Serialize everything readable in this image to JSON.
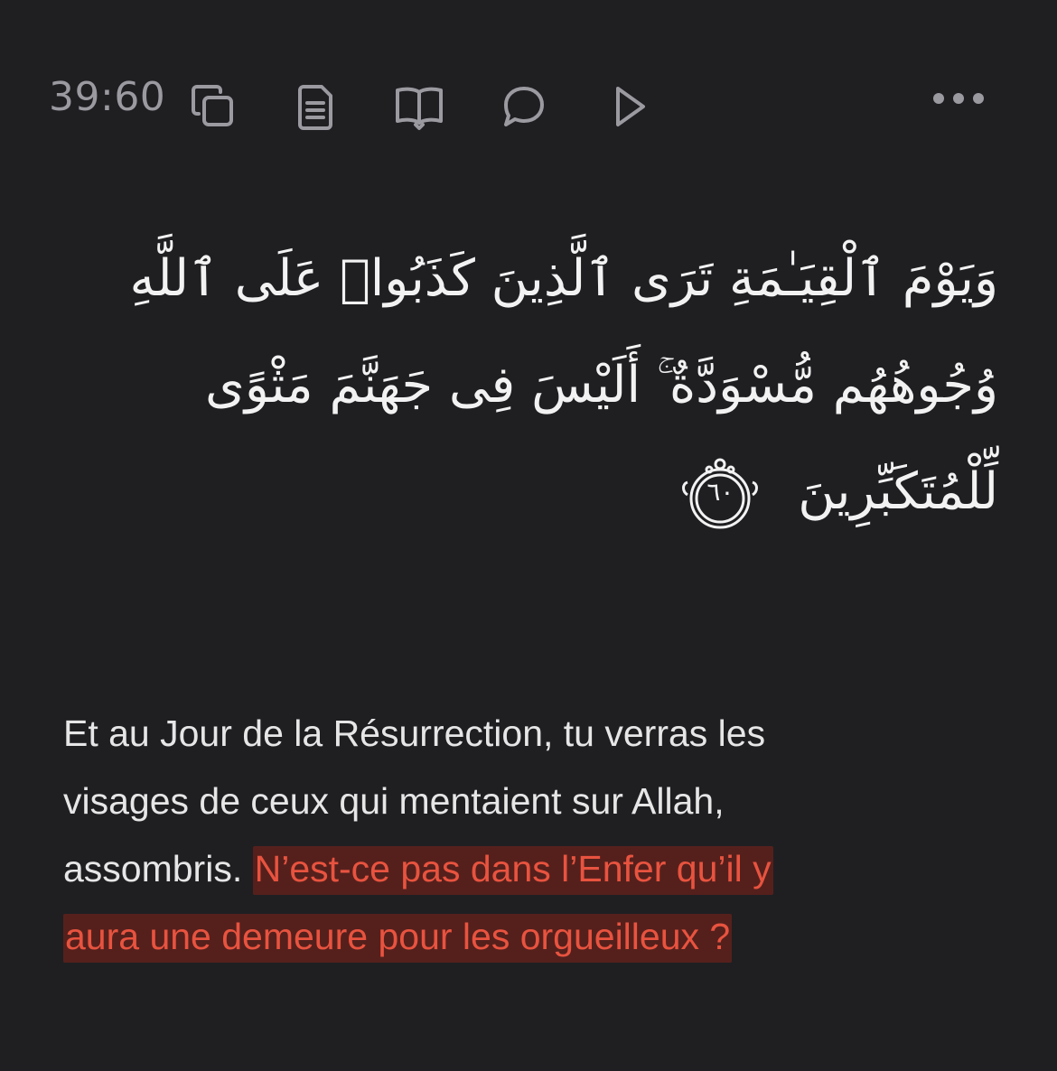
{
  "toolbar": {
    "verse_ref": "39:60",
    "icons": [
      "copy-icon",
      "document-icon",
      "book-icon",
      "comment-icon",
      "play-icon",
      "more-icon"
    ]
  },
  "arabic": {
    "line1": "وَيَوْمَ ٱلْقِيَـٰمَةِ تَرَى ٱلَّذِينَ كَذَبُوا۟ عَلَى ٱللَّهِ",
    "line2": "وُجُوهُهُم مُّسْوَدَّةٌ ۚ أَلَيْسَ فِى جَهَنَّمَ مَثْوًى",
    "line3": "لِّلْمُتَكَبِّرِينَ",
    "ayah_number": "٦٠"
  },
  "translation": {
    "line1": "Et au Jour de la Résurrection, tu verras les",
    "line2": "visages de ceux qui mentaient sur Allah,",
    "line3_plain": "assombris. ",
    "line3_highlight": "N’est-ce pas dans l’Enfer qu’il y",
    "line4_highlight": "aura une demeure pour les orgueilleux ?"
  },
  "colors": {
    "background": "#1f1f22",
    "icon": "#9a9aa0",
    "highlight_text": "#e8533f",
    "highlight_bg": "#55201c"
  }
}
